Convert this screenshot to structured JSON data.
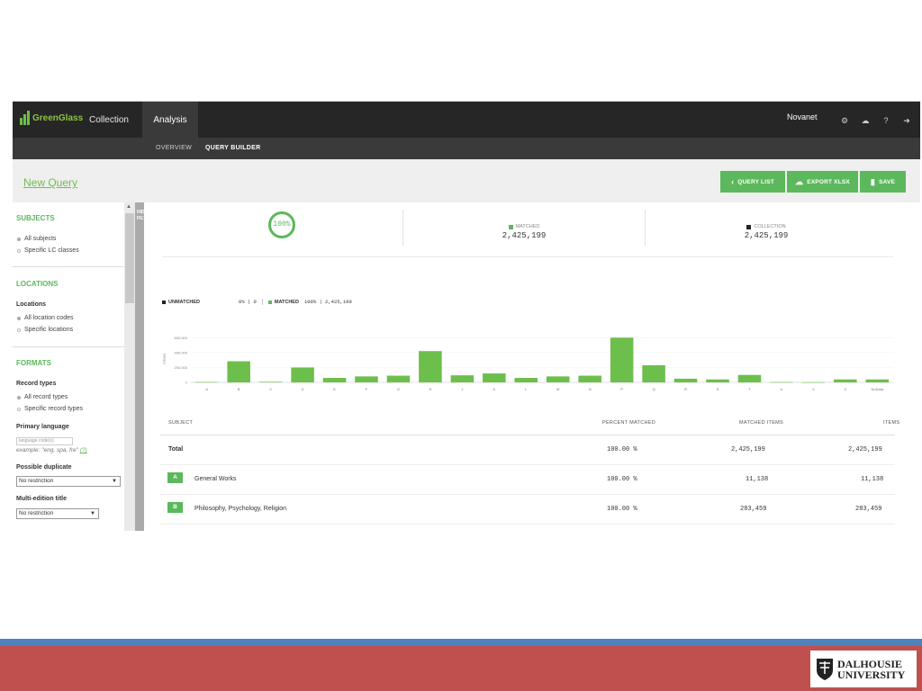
{
  "app": {
    "logo_text": "GreenGlass",
    "tabs": [
      "Collection",
      "Analysis"
    ],
    "user": "Novanet",
    "subtabs": [
      "OVERVIEW",
      "QUERY BUILDER"
    ]
  },
  "query": {
    "title": "New Query",
    "buttons": [
      "QUERY LIST",
      "EXPORT XLSX",
      "SAVE"
    ]
  },
  "sidebar": {
    "subjects_heading": "SUBJECTS",
    "subjects_options": [
      "All subjects",
      "Specific LC classes"
    ],
    "locations_heading": "LOCATIONS",
    "locations_label": "Locations",
    "locations_options": [
      "All location codes",
      "Specific locations"
    ],
    "formats_heading": "FORMATS",
    "record_types_label": "Record types",
    "record_types_options": [
      "All record types",
      "Specific record types"
    ],
    "primary_language_label": "Primary language",
    "language_placeholder": "language code(s)",
    "language_example": "example: \"eng, spa, fre\"",
    "language_help": "(?)",
    "possible_duplicate_label": "Possible duplicate",
    "possible_duplicate_value": "No restriction",
    "multi_edition_label": "Multi-edition title",
    "multi_edition_value": "No restriction",
    "hide_filters": "HIDE FILTERS"
  },
  "summary": {
    "percent": "100%",
    "matched_label": "MATCHED",
    "matched_value": "2,425,199",
    "collection_label": "COLLECTION",
    "collection_value": "2,425,199"
  },
  "legend": {
    "unmatched_label": "UNMATCHED",
    "unmatched_value": "0% | 0",
    "matched_label": "MATCHED",
    "matched_value": "100% | 2,425,199"
  },
  "colors": {
    "accent": "#5cb85c",
    "topbar": "#262626",
    "subbar": "#3a3a3a",
    "blue_stripe": "#4f81bd",
    "red_band": "#c0504d"
  },
  "chart_data": {
    "type": "bar",
    "categories": [
      "A",
      "B",
      "C",
      "D",
      "E",
      "F",
      "G",
      "H",
      "J",
      "K",
      "L",
      "M",
      "N",
      "P",
      "Q",
      "R",
      "S",
      "T",
      "U",
      "V",
      "Z",
      "NoData"
    ],
    "values": [
      5000,
      283459,
      8000,
      200000,
      60000,
      80000,
      90000,
      420000,
      95000,
      120000,
      60000,
      80000,
      90000,
      600000,
      230000,
      50000,
      40000,
      100000,
      4000,
      2000,
      40000,
      40000
    ],
    "ylabel": "ITEMS",
    "ytick_labels": [
      "0",
      "200,000",
      "400,000",
      "600,000"
    ],
    "ylim": [
      0,
      700000
    ]
  },
  "table": {
    "headers": [
      "SUBJECT",
      "PERCENT MATCHED",
      "MATCHED ITEMS",
      "ITEMS"
    ],
    "total": {
      "label": "Total",
      "percent": "100.00 %",
      "matched": "2,425,199",
      "items": "2,425,199"
    },
    "rows": [
      {
        "code": "A",
        "name": "General Works",
        "percent": "100.00 %",
        "matched": "11,138",
        "items": "11,138"
      },
      {
        "code": "B",
        "name": "Philosophy, Psychology, Religion",
        "percent": "100.00 %",
        "matched": "283,459",
        "items": "283,459"
      }
    ]
  },
  "footer": {
    "logo_line1": "DALHOUSIE",
    "logo_line2": "UNIVERSITY"
  }
}
